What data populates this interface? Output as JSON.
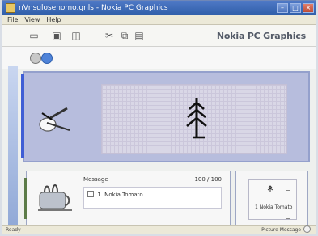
{
  "window": {
    "title": "nVnsglosenomo.gnls - Nokia PC Graphics"
  },
  "menu": {
    "items": [
      "File",
      "View",
      "Help"
    ]
  },
  "toolbar": {
    "brand": "Nokia PC Graphics",
    "icons": [
      "new-icon",
      "open-icon",
      "save-icon",
      "cut-icon",
      "copy-icon",
      "paste-icon"
    ]
  },
  "subbar": {
    "icons": [
      "small-phone-icon",
      "globe-icon"
    ]
  },
  "main_panel": {
    "icons": [
      "paint-brush-icon",
      "tree-logo-icon"
    ]
  },
  "list_panel": {
    "header_left": "Message",
    "header_right": "100 / 100",
    "items": [
      {
        "label": "1. Nokia Tomato"
      }
    ]
  },
  "preview_panel": {
    "label": "1 Nokia Tomato"
  },
  "statusbar": {
    "left": "Ready",
    "right": "Picture Message"
  },
  "colors": {
    "title_bar": "#2f5ea9",
    "panel_bg": "#b7bddd",
    "accent_blue": "#3f5ed5",
    "accent_green": "#5c7b48"
  }
}
